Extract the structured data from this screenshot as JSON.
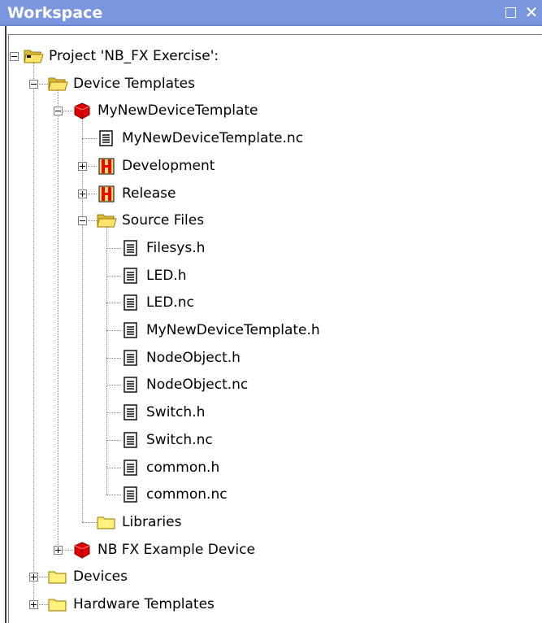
{
  "window": {
    "title": "Workspace",
    "restore_symbol": "□",
    "close_symbol": "✕"
  },
  "colors": {
    "titlebar": "#7a96df",
    "folder": "#ffe36b",
    "device": "#e00000",
    "config": "#ff0000"
  },
  "tree": [
    {
      "label": "Project 'NB_FX Exercise':",
      "icon": "project-folder-icon",
      "level": 0,
      "expander": "minus"
    },
    {
      "label": "Device Templates",
      "icon": "folder-open-icon",
      "level": 1,
      "expander": "minus"
    },
    {
      "label": "MyNewDeviceTemplate",
      "icon": "device-template-icon",
      "level": 2,
      "expander": "minus"
    },
    {
      "label": "MyNewDeviceTemplate.nc",
      "icon": "file-icon",
      "level": 3,
      "expander": null
    },
    {
      "label": "Development",
      "icon": "build-config-icon",
      "level": 3,
      "expander": "plus"
    },
    {
      "label": "Release",
      "icon": "build-config-icon",
      "level": 3,
      "expander": "plus"
    },
    {
      "label": "Source Files",
      "icon": "folder-open-icon",
      "level": 3,
      "expander": "minus"
    },
    {
      "label": "Filesys.h",
      "icon": "file-icon",
      "level": 4,
      "expander": null
    },
    {
      "label": "LED.h",
      "icon": "file-icon",
      "level": 4,
      "expander": null
    },
    {
      "label": "LED.nc",
      "icon": "file-icon",
      "level": 4,
      "expander": null
    },
    {
      "label": "MyNewDeviceTemplate.h",
      "icon": "file-icon",
      "level": 4,
      "expander": null
    },
    {
      "label": "NodeObject.h",
      "icon": "file-icon",
      "level": 4,
      "expander": null
    },
    {
      "label": "NodeObject.nc",
      "icon": "file-icon",
      "level": 4,
      "expander": null
    },
    {
      "label": "Switch.h",
      "icon": "file-icon",
      "level": 4,
      "expander": null
    },
    {
      "label": "Switch.nc",
      "icon": "file-icon",
      "level": 4,
      "expander": null
    },
    {
      "label": "common.h",
      "icon": "file-icon",
      "level": 4,
      "expander": null
    },
    {
      "label": "common.nc",
      "icon": "file-icon",
      "level": 4,
      "expander": null
    },
    {
      "label": "Libraries",
      "icon": "folder-icon",
      "level": 3,
      "expander": null
    },
    {
      "label": "NB FX Example Device",
      "icon": "device-template-icon",
      "level": 2,
      "expander": "plus"
    },
    {
      "label": "Devices",
      "icon": "folder-icon",
      "level": 1,
      "expander": "plus"
    },
    {
      "label": "Hardware Templates",
      "icon": "folder-icon",
      "level": 1,
      "expander": "plus"
    }
  ]
}
